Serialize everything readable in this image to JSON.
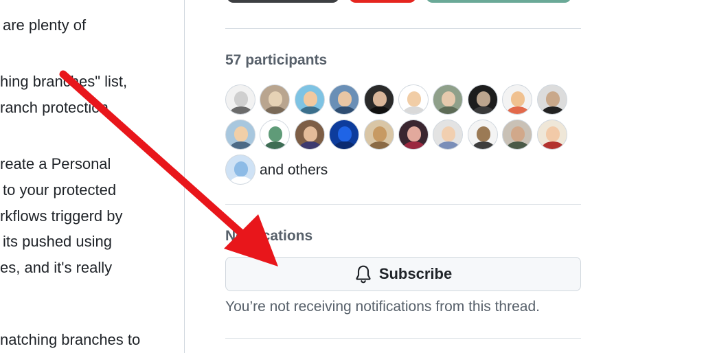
{
  "comment": {
    "lines": [
      "are plenty of",
      "hing branches\" list,",
      "ranch protection",
      "reate a Personal",
      "to your protected",
      "rkflows triggerd by",
      "its pushed using",
      "es, and it's really",
      "natching branches to"
    ]
  },
  "participants": {
    "heading": "57 participants",
    "others_label": "and others",
    "avatar_count": 21
  },
  "notifications": {
    "heading": "Notifications",
    "subscribe_label": "Subscribe",
    "status_text": "You’re not receiving notifications from this thread."
  },
  "colors": {
    "annotation_arrow": "#e8161b",
    "top_button_dark": "#3d3f42",
    "top_button_red": "#e5251f",
    "top_button_teal": "#6aa997"
  },
  "icons": {
    "subscribe": "bell-icon"
  }
}
